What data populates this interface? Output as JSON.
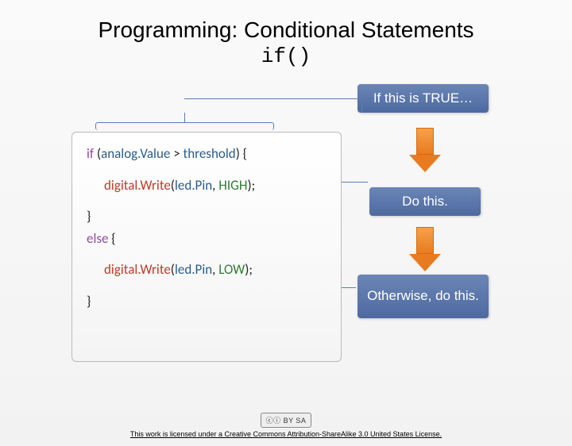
{
  "title": "Programming:  Conditional Statements",
  "subtitle": "if()",
  "callouts": {
    "c1": "If this is TRUE…",
    "c2": "Do this.",
    "c3": "Otherwise, do this."
  },
  "code": {
    "if_kw": "if",
    "cond_open": " (",
    "cond_lhs": "analog.Value",
    "cond_op": " > ",
    "cond_rhs": "threshold",
    "cond_close": ") {",
    "fn": "digital.Write",
    "argsep": "(",
    "arg1": "led.Pin",
    "comma": ", ",
    "high": "HIGH",
    "low": "LOW",
    "argend": ");",
    "close_brace": "}",
    "else_kw": "else",
    "else_open": " {"
  },
  "footer": {
    "badge": "ⓒⓘ BY SA",
    "text": "This work is licensed under a Creative Commons Attribution-ShareAlike 3.0 United States License."
  }
}
